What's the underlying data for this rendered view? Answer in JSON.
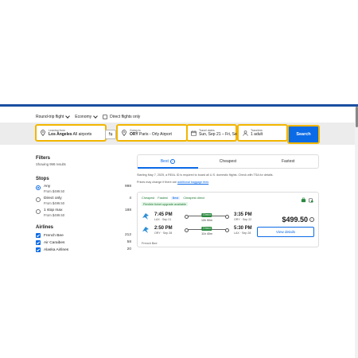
{
  "trip_options": {
    "trip_type": "Round-trip flight",
    "cabin": "Economy",
    "direct_only_label": "Direct flights only"
  },
  "search": {
    "from_label": "Leaving from",
    "from_city": "Los Angeles",
    "from_airports": "All airports",
    "to_label": "Going to",
    "to_code": "ORY",
    "to_rest": "Paris - Orly Airport",
    "dates_label": "Travel dates",
    "dates_value": "Sun, Sep 21 – Fri, Sep...",
    "travelers_label": "Travelers",
    "travelers_value": "1 adult",
    "swap_symbol": "⇆",
    "search_button": "Search"
  },
  "filters": {
    "title": "Filters",
    "showing": "Showing 998 results",
    "stops_title": "Stops",
    "stops": [
      {
        "label": "Any",
        "count": "998",
        "price": "From $499.50",
        "selected": true
      },
      {
        "label": "Direct only",
        "count": "4",
        "price": "From $499.50",
        "selected": false
      },
      {
        "label": "1 stop max",
        "count": "188",
        "price": "From $499.50",
        "selected": false
      }
    ],
    "airlines_title": "Airlines",
    "airlines": [
      {
        "label": "French Bee",
        "count": "212"
      },
      {
        "label": "Air Caraibes",
        "count": "58"
      },
      {
        "label": "Alaska Airlines",
        "count": "20"
      }
    ]
  },
  "sort_tabs": [
    {
      "label": "Best",
      "active": true
    },
    {
      "label": "Cheapest",
      "active": false
    },
    {
      "label": "Fastest",
      "active": false
    }
  ],
  "notices": {
    "realid": "Starting May 7, 2025, a REAL ID is required to board all U.S. domestic flights. Check with TSA for details.",
    "prices_prefix": "Prices may change if there are ",
    "prices_link": "additional baggage fees"
  },
  "result": {
    "badges": [
      "Cheapest",
      "Fastest",
      "Best",
      "Cheapest direct"
    ],
    "flex_note": "Flexible ticket upgrade available",
    "outbound": {
      "dep_time": "7:45 PM",
      "dep_airport": "LAX · Sep 21",
      "arr_time": "3:35 PM",
      "arr_airport": "ORY · Sep 22",
      "stop_label": "Direct",
      "duration": "10h 50m"
    },
    "return": {
      "dep_time": "2:50 PM",
      "dep_airport": "ORY · Sep 28",
      "arr_time": "5:30 PM",
      "arr_airport": "LAX · Sep 28",
      "stop_label": "Direct",
      "duration": "11h 40m"
    },
    "airline": "French Bee",
    "price": "$499.50",
    "view_details": "View details"
  },
  "colors": {
    "brand_blue": "#0b6ae6",
    "highlight_yellow": "#f2b600",
    "direct_green": "#2a8a3f",
    "header_navy": "#1a4fa0"
  }
}
